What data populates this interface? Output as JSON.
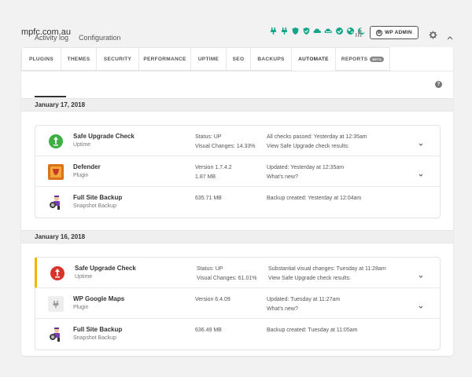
{
  "header": {
    "site_name": "mpfc.com.au",
    "wp_admin_label": "WP ADMIN",
    "status_icons": [
      "plugin-icon",
      "plugin-icon",
      "shield-icon",
      "shield-icon",
      "cloud-icon",
      "cloud-icon",
      "check-icon",
      "globe-icon",
      "moon-icon",
      "bar-chart-icon"
    ],
    "accent_color": "#17a589"
  },
  "tabs": [
    {
      "label": "PLUGINS"
    },
    {
      "label": "THEMES"
    },
    {
      "label": "SECURITY"
    },
    {
      "label": "PERFORMANCE"
    },
    {
      "label": "UPTIME"
    },
    {
      "label": "SEO"
    },
    {
      "label": "BACKUPS"
    },
    {
      "label": "AUTOMATE",
      "active": true
    },
    {
      "label": "REPORTS",
      "badge": "BETA"
    }
  ],
  "subnav": {
    "activity_log": "Activity log",
    "configuration": "Configuration"
  },
  "groups": [
    {
      "date": "January 17, 2018",
      "rows": [
        {
          "title": "Safe Upgrade Check",
          "subtitle": "Uptime",
          "c1a": "Status: UP",
          "c1b": "Visual Changes: 14.33%",
          "c2a": "All checks passed: Yesterday at 12:35am",
          "c2b": "View Safe Upgrade check results:",
          "icon": "uptime-green-icon"
        },
        {
          "title": "Defender",
          "subtitle": "Plugin",
          "c1a": "Version 1.7.4.2",
          "c1b": "1.87 MB",
          "c2a": "Updated: Yesterday at 12:35am",
          "c2b": "What's new?",
          "icon": "defender-plugin-icon"
        },
        {
          "title": "Full Site Backup",
          "subtitle": "Snapshot Backup",
          "c1a": "635.71 MB",
          "c1b": "",
          "c2a": "Backup created: Yesterday at 12:04am",
          "c2b": "",
          "icon": "snapshot-backup-icon"
        }
      ]
    },
    {
      "date": "January 16, 2018",
      "rows": [
        {
          "title": "Safe Upgrade Check",
          "subtitle": "Uptime",
          "c1a": "Status: UP",
          "c1b": "Visual Changes: 61.01%",
          "c2a": "Substantial visual changes: Tuesday at 11:28am",
          "c2b": "View Safe Upgrade check results:",
          "icon": "uptime-red-icon",
          "warn": true
        },
        {
          "title": "WP Google Maps",
          "subtitle": "Plugin",
          "c1a": "Version 6.4.09",
          "c1b": "",
          "c2a": "Updated: Tuesday at 11:27am",
          "c2b": "What's new?",
          "icon": "plugin-placeholder-icon"
        },
        {
          "title": "Full Site Backup",
          "subtitle": "Snapshot Backup",
          "c1a": "636.49 MB",
          "c1b": "",
          "c2a": "Backup created: Tuesday at 11:05am",
          "c2b": "",
          "icon": "snapshot-backup-icon"
        }
      ]
    }
  ]
}
